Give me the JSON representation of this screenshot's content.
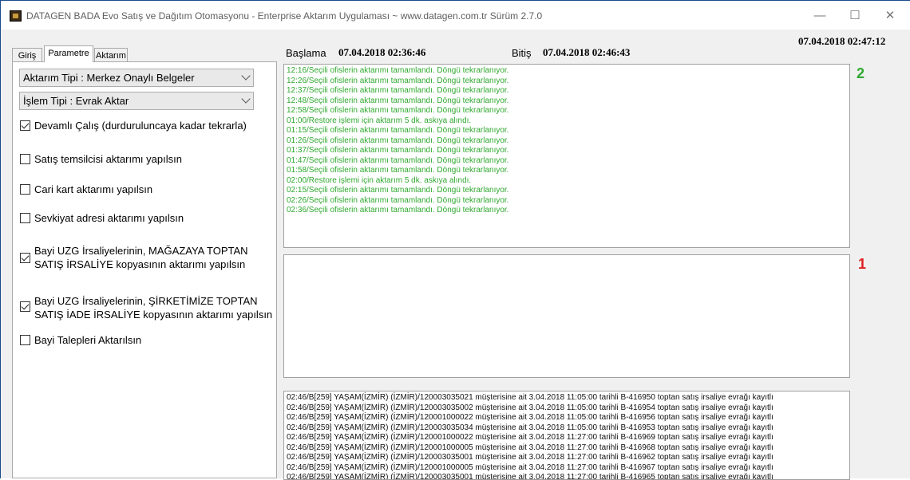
{
  "window": {
    "title": "DATAGEN BADA  Evo Satış ve Dağıtım Otomasyonu - Enterprise Aktarım Uygulaması ~ www.datagen.com.tr Sürüm 2.7.0",
    "minimize": "—",
    "maximize": "☐",
    "close": "✕"
  },
  "clock": "07.04.2018 02:47:12",
  "timing": {
    "start_label": "Başlama",
    "start_value": "07.04.2018 02:36:46",
    "end_label": "Bitiş",
    "end_value": "07.04.2018 02:46:43"
  },
  "tabs": [
    {
      "label": "Giriş"
    },
    {
      "label": "Parametre",
      "active": true
    },
    {
      "label": "Aktarım"
    }
  ],
  "params": {
    "transfer_type": "Aktarım Tipi : Merkez Onaylı Belgeler",
    "process_type": "İşlem Tipi : Evrak Aktar",
    "options": [
      {
        "label": "Devamlı Çalış (durduruluncaya kadar tekrarla)",
        "checked": true
      },
      {
        "label": "Satış temsilcisi aktarımı yapılsın",
        "checked": false
      },
      {
        "label": "Cari kart aktarımı yapılsın",
        "checked": false
      },
      {
        "label": "Sevkiyat adresi aktarımı yapılsın",
        "checked": false
      },
      {
        "label": "Bayi UZG İrsaliyelerinin, MAĞAZAYA TOPTAN",
        "label2": "SATIŞ İRSALİYE kopyasının aktarımı yapılsın",
        "checked": true
      },
      {
        "label": "Bayi UZG İrsaliyelerinin, ŞİRKETİMİZE TOPTAN",
        "label2": "SATIŞ İADE İRSALİYE kopyasının aktarımı yapılsın",
        "checked": true
      },
      {
        "label": "Bayi Talepleri Aktarılsın",
        "checked": false
      }
    ]
  },
  "markers": {
    "top": "2",
    "middle": "1"
  },
  "colors": {
    "marker_top": "#2fa82f",
    "marker_middle": "#e02020",
    "log_green": "#2fa82f"
  },
  "status_log": [
    "12:16/Seçili ofislerin aktarımı tamamlandı. Döngü tekrarlanıyor.",
    "12:26/Seçili ofislerin aktarımı tamamlandı. Döngü tekrarlanıyor.",
    "12:37/Seçili ofislerin aktarımı tamamlandı. Döngü tekrarlanıyor.",
    "12:48/Seçili ofislerin aktarımı tamamlandı. Döngü tekrarlanıyor.",
    "12:58/Seçili ofislerin aktarımı tamamlandı. Döngü tekrarlanıyor.",
    "01:00/Restore işlemi için aktarım 5 dk. askıya alındı.",
    "01:15/Seçili ofislerin aktarımı tamamlandı. Döngü tekrarlanıyor.",
    "01:26/Seçili ofislerin aktarımı tamamlandı. Döngü tekrarlanıyor.",
    "01:37/Seçili ofislerin aktarımı tamamlandı. Döngü tekrarlanıyor.",
    "01:47/Seçili ofislerin aktarımı tamamlandı. Döngü tekrarlanıyor.",
    "01:58/Seçili ofislerin aktarımı tamamlandı. Döngü tekrarlanıyor.",
    "02:00/Restore işlemi için aktarım 5 dk. askıya alındı.",
    "02:15/Seçili ofislerin aktarımı tamamlandı. Döngü tekrarlanıyor.",
    "02:26/Seçili ofislerin aktarımı tamamlandı. Döngü tekrarlanıyor.",
    "02:36/Seçili ofislerin aktarımı tamamlandı. Döngü tekrarlanıyor."
  ],
  "detail_log": [
    "02:46/B[259] YAŞAM(İZMİR) (İZMİR)/120003035021 müşterisine ait 3.04.2018 11:05:00 tarihli B-416950 toptan satış irsaliye evrağı  kayıtlı",
    "02:46/B[259] YAŞAM(İZMİR) (İZMİR)/120003035002 müşterisine ait 3.04.2018 11:05:00 tarihli B-416954 toptan satış irsaliye evrağı  kayıtlı",
    "02:46/B[259] YAŞAM(İZMİR) (İZMİR)/120001000022 müşterisine ait 3.04.2018 11:05:00 tarihli B-416956 toptan satış irsaliye evrağı  kayıtlı",
    "02:46/B[259] YAŞAM(İZMİR) (İZMİR)/120003035034 müşterisine ait 3.04.2018 11:05:00 tarihli B-416953 toptan satış irsaliye evrağı  kayıtlı",
    "02:46/B[259] YAŞAM(İZMİR) (İZMİR)/120001000022 müşterisine ait 3.04.2018 11:27:00 tarihli B-416969 toptan satış irsaliye evrağı  kayıtlı",
    "02:46/B[259] YAŞAM(İZMİR) (İZMİR)/120001000005 müşterisine ait 3.04.2018 11:27:00 tarihli B-416968 toptan satış irsaliye evrağı  kayıtlı",
    "02:46/B[259] YAŞAM(İZMİR) (İZMİR)/120003035001 müşterisine ait 3.04.2018 11:27:00 tarihli B-416962 toptan satış irsaliye evrağı  kayıtlı",
    "02:46/B[259] YAŞAM(İZMİR) (İZMİR)/120001000005 müşterisine ait 3.04.2018 11:27:00 tarihli B-416967 toptan satış irsaliye evrağı  kayıtlı",
    "02:46/B[259] YAŞAM(İZMİR) (İZMİR)/120003035001 müşterisine ait 3.04.2018 11:27:00 tarihli B-416965 toptan satış irsaliye evrağı  kayıtlı"
  ]
}
